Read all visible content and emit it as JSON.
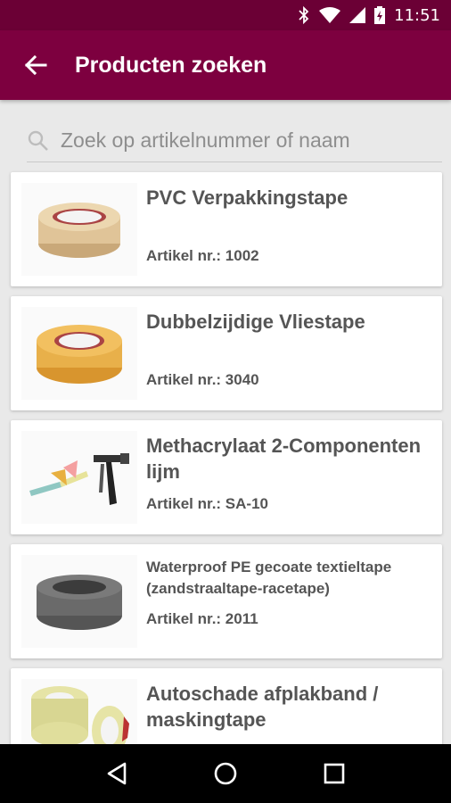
{
  "status_bar": {
    "time": "11:51"
  },
  "header": {
    "title": "Producten zoeken",
    "back_icon": "arrow-left-icon"
  },
  "search": {
    "placeholder": "Zoek op artikelnummer of naam",
    "value": ""
  },
  "products": [
    {
      "name": "PVC Verpakkingstape",
      "article": "Artikel nr.: 1002"
    },
    {
      "name": "Dubbelzijdige Vliestape",
      "article": "Artikel nr.: 3040"
    },
    {
      "name": "Methacrylaat 2-Componenten lijm",
      "article": "Artikel nr.: SA-10"
    },
    {
      "name": "Waterproof PE gecoate textieltape (zandstraaltape-racetape)",
      "article": "Artikel nr.: 2011"
    },
    {
      "name": "Autoschade afplakband / maskingtape",
      "article": ""
    }
  ],
  "nav": {
    "back_icon": "nav-back-icon",
    "home_icon": "nav-home-icon",
    "recents_icon": "nav-recents-icon"
  },
  "colors": {
    "status_bar": "#6b0035",
    "app_bar": "#7d003f",
    "background": "#e9e9e9"
  }
}
